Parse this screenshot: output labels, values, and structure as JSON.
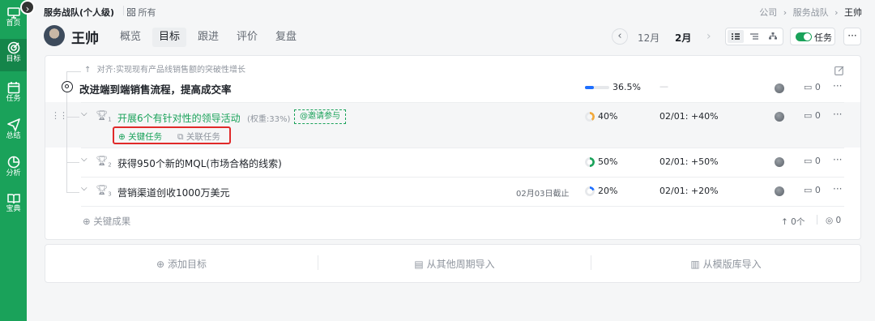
{
  "sidebar": {
    "items": [
      {
        "label": "首页",
        "icon": "monitor-icon"
      },
      {
        "label": "目标",
        "icon": "target-icon"
      },
      {
        "label": "任务",
        "icon": "calendar-icon"
      },
      {
        "label": "总结",
        "icon": "send-icon"
      },
      {
        "label": "分析",
        "icon": "pie-chart-icon"
      },
      {
        "label": "宝典",
        "icon": "book-icon"
      }
    ]
  },
  "header": {
    "team": "服务战队(个人级)",
    "scope": "所有",
    "breadcrumb": [
      "公司",
      "服务战队",
      "王帅"
    ],
    "user_name": "王帅",
    "tabs": [
      "概览",
      "目标",
      "跟进",
      "评价",
      "复盘"
    ],
    "active_tab": "目标",
    "period_prev": "12月",
    "period_current": "2月",
    "task_toggle": "任务"
  },
  "objective": {
    "align_text": "对齐:实现现有产品线销售额的突破性增长",
    "title": "改进端到端销售流程，提高成交率",
    "progress": "36.5%",
    "progress_value": 0.365,
    "status": "—",
    "comments": "0"
  },
  "key_results": [
    {
      "index": "1",
      "title": "开展6个有针对性的领导活动",
      "weight": "(权重:33%)",
      "invite": "@邀请参与",
      "deadline": "",
      "progress": "40%",
      "progress_value": 0.4,
      "update": "02/01: +40%",
      "comments": "0"
    },
    {
      "index": "2",
      "title": "获得950个新的MQL(市场合格的线索)",
      "weight": "",
      "invite": "",
      "deadline": "",
      "progress": "50%",
      "progress_value": 0.5,
      "update": "02/01: +50%",
      "comments": "0"
    },
    {
      "index": "3",
      "title": "营销渠道创收1000万美元",
      "weight": "",
      "invite": "",
      "deadline": "02月03日截止",
      "progress": "20%",
      "progress_value": 0.2,
      "update": "02/01: +20%",
      "comments": "0"
    }
  ],
  "kr_actions": {
    "key_task": "关键任务",
    "link_task": "关联任务"
  },
  "add_kr": "关键成果",
  "footer_stats": {
    "up": "0个",
    "views": "0"
  },
  "bottom_actions": {
    "add_objective": "添加目标",
    "import_period": "从其他周期导入",
    "import_template": "从模版库导入"
  },
  "colors": {
    "brand": "#1aa25a",
    "link": "#1aa25a",
    "progress": "#1e6fff",
    "highlight_border": "#e02a2a"
  }
}
